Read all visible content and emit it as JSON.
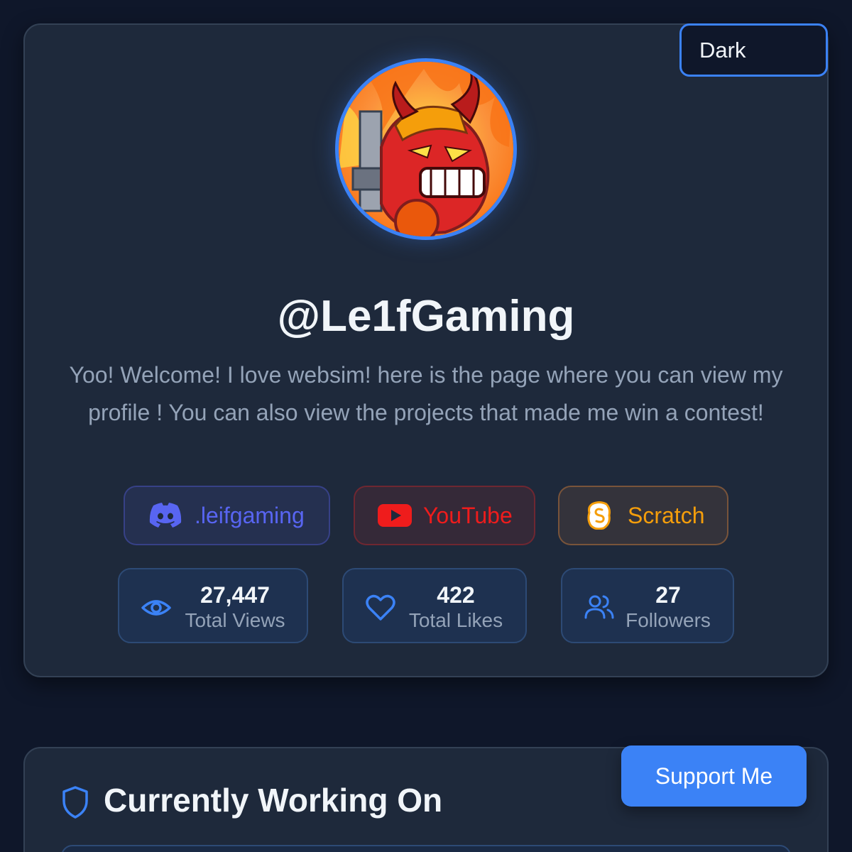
{
  "theme_selector": {
    "value": "Dark"
  },
  "profile": {
    "username": "@Le1fGaming",
    "bio": "Yoo! Welcome! I love websim! here is the page where you can view my profile ! You can also view the projects that made me win a contest!"
  },
  "socials": [
    {
      "label": ".leifgaming",
      "icon": "discord-icon",
      "color": "#5865f2"
    },
    {
      "label": "YouTube",
      "icon": "youtube-icon",
      "color": "#ef1c1c"
    },
    {
      "label": "Scratch",
      "icon": "scratch-icon",
      "color": "#f59e0b"
    }
  ],
  "stats": [
    {
      "value": "27,447",
      "label": "Total Views",
      "icon": "eye-icon"
    },
    {
      "value": "422",
      "label": "Total Likes",
      "icon": "heart-icon"
    },
    {
      "value": "27",
      "label": "Followers",
      "icon": "users-icon"
    }
  ],
  "working_on": {
    "title": "Currently Working On",
    "icon": "shield-icon"
  },
  "support_button": {
    "label": "Support Me"
  },
  "colors": {
    "accent": "#3b82f6",
    "background": "#0f172a",
    "card": "#1e293b"
  }
}
